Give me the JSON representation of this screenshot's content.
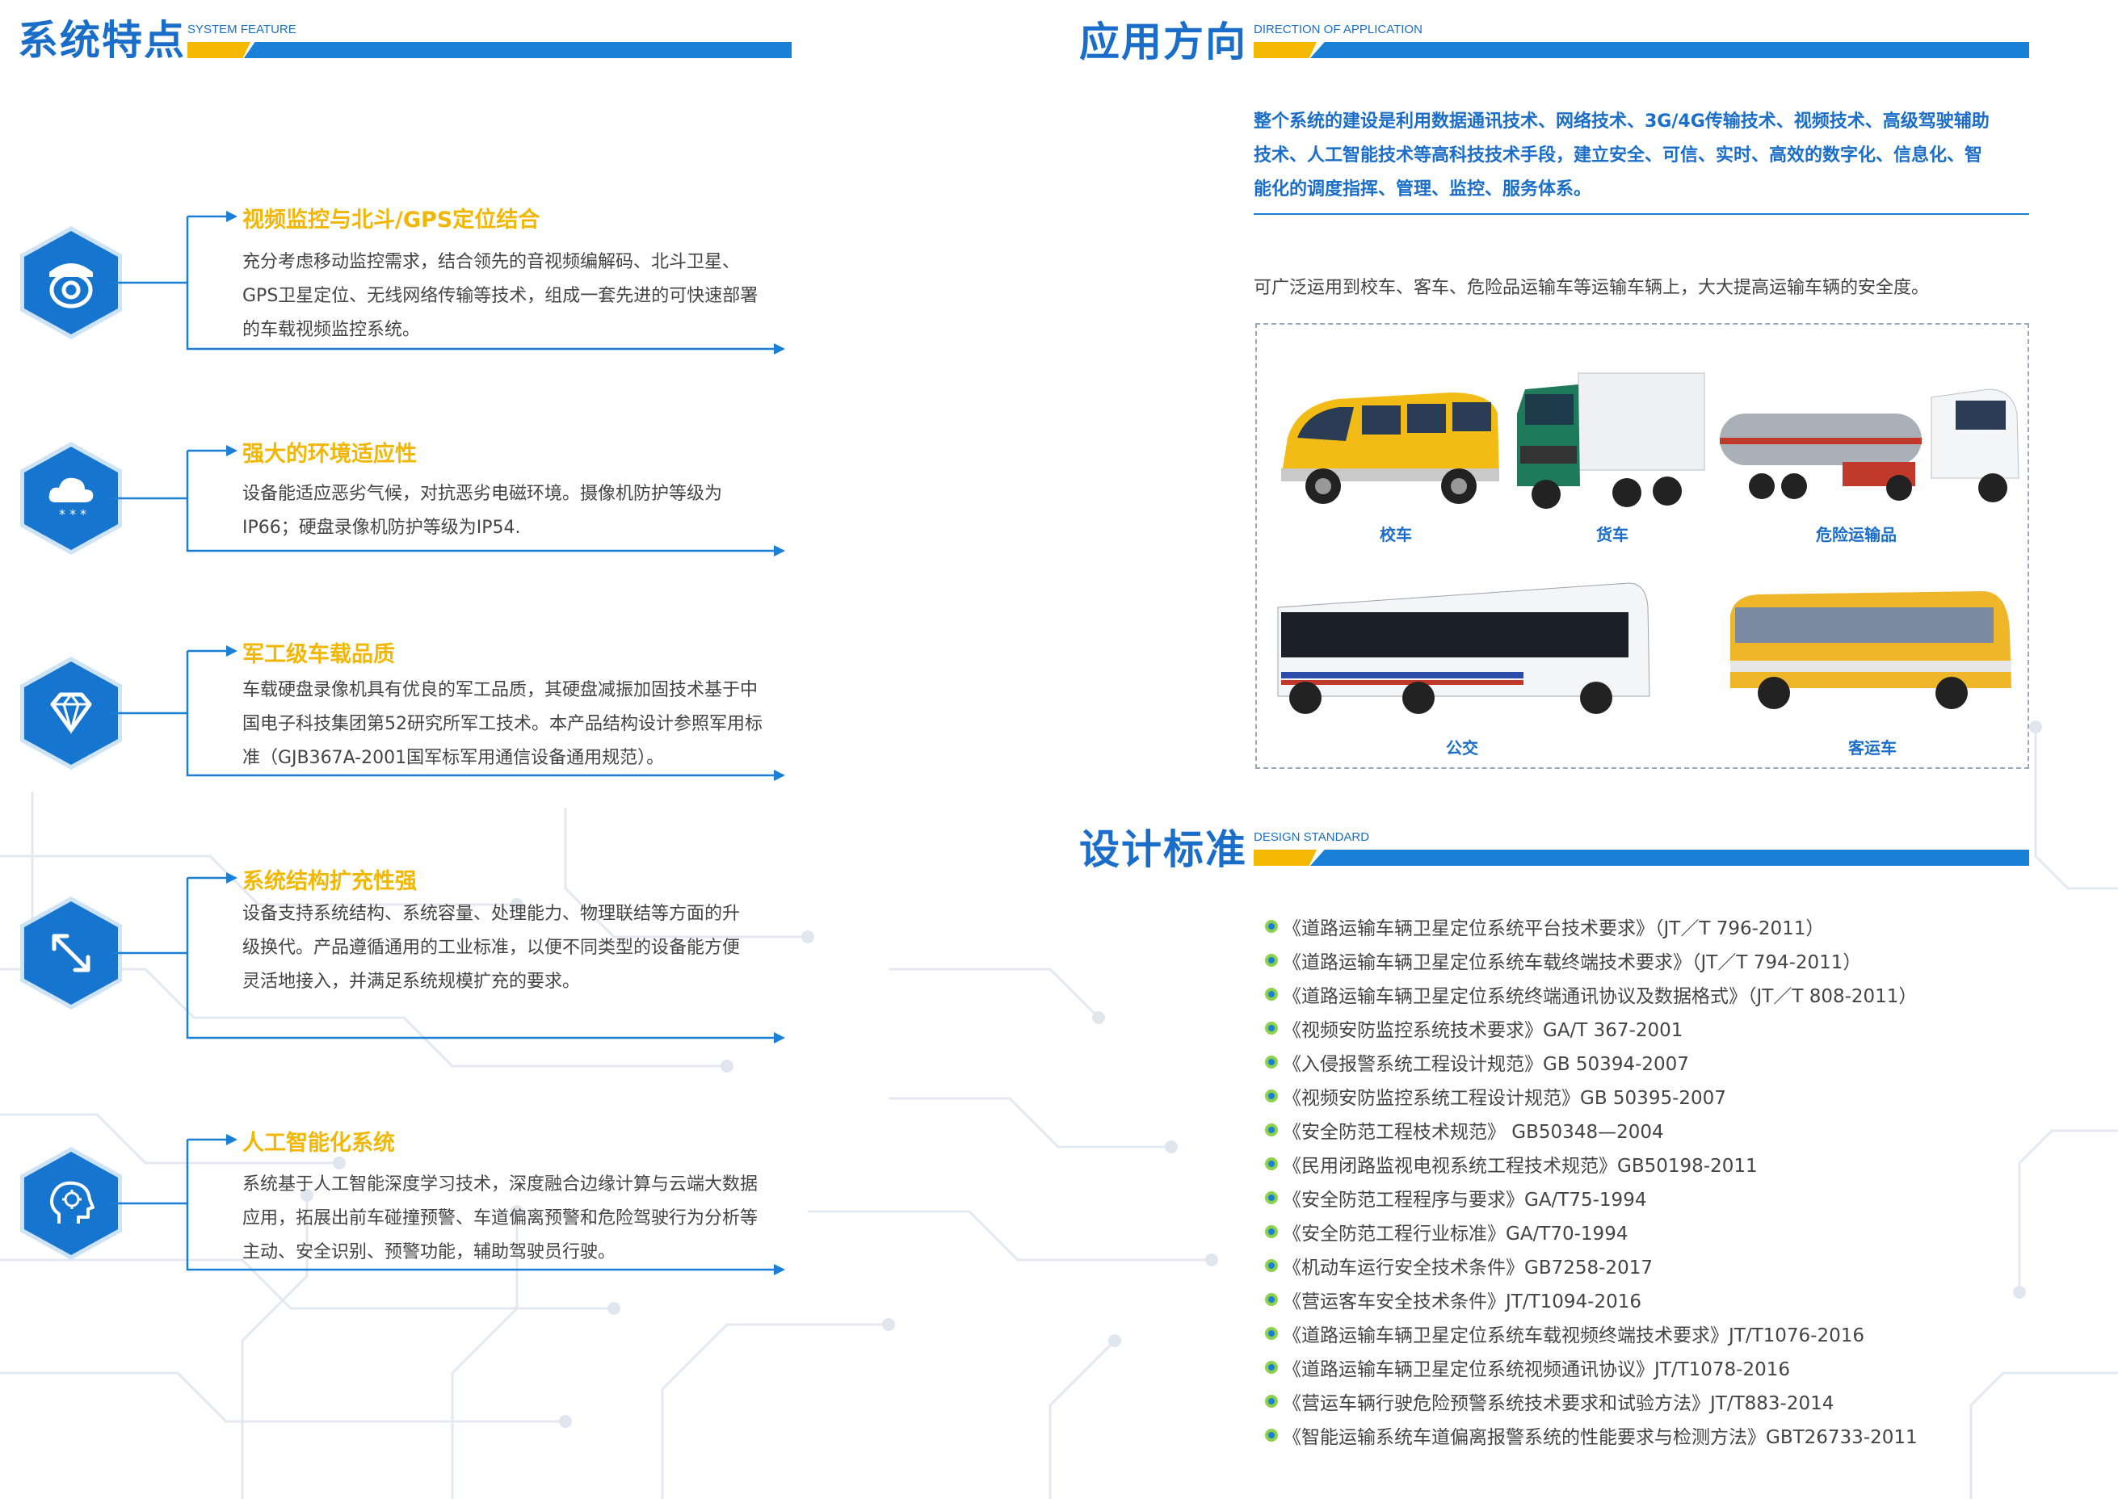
{
  "left": {
    "title": "系统特点",
    "subtitle": "SYSTEM FEATURE",
    "features": [
      {
        "title": "视频监控与北斗/GPS定位结合",
        "lines": [
          "充分考虑移动监控需求，结合领先的音视频编解码、北斗卫星、",
          "GPS卫星定位、无线网络传输等技术，组成一套先进的可快速部署",
          "的车载视频监控系统。"
        ],
        "icon": "camera-icon"
      },
      {
        "title": "强大的环境适应性",
        "lines": [
          "设备能适应恶劣气候，对抗恶劣电磁环境。摄像机防护等级为",
          "IP66；硬盘录像机防护等级为IP54."
        ],
        "icon": "snow-cloud-icon"
      },
      {
        "title": "军工级车载品质",
        "lines": [
          "车载硬盘录像机具有优良的军工品质，其硬盘减振加固技术基于中",
          "国电子科技集团第52研究所军工技术。本产品结构设计参照军用标",
          "准（GJB367A-2001国军标军用通信设备通用规范）。"
        ],
        "icon": "diamond-icon"
      },
      {
        "title": "系统结构扩充性强",
        "lines": [
          "设备支持系统结构、系统容量、处理能力、物理联结等方面的升",
          "级换代。产品遵循通用的工业标准，以便不同类型的设备能方便",
          "灵活地接入，并满足系统规模扩充的要求。"
        ],
        "icon": "expand-arrows-icon"
      },
      {
        "title": "人工智能化系统",
        "lines": [
          "系统基于人工智能深度学习技术，深度融合边缘计算与云端大数据",
          "应用，拓展出前车碰撞预警、车道偏离预警和危险驾驶行为分析等",
          "主动、安全识别、预警功能，辅助驾驶员行驶。"
        ],
        "icon": "ai-head-icon"
      }
    ]
  },
  "application": {
    "title": "应用方向",
    "subtitle": "DIRECTION OF APPLICATION",
    "intro": [
      "整个系统的建设是利用数据通讯技术、网络技术、3G/4G传输技术、视频技术、高级驾驶辅助",
      "技术、人工智能技术等高科技技术手段，建立安全、可信、实时、高效的数字化、信息化、智",
      "能化的调度指挥、管理、监控、服务体系。"
    ],
    "text": "可广泛运用到校车、客车、危险品运输车等运输车辆上，大大提高运输车辆的安全度。",
    "vehicles": [
      "校车",
      "货车",
      "危险运输品",
      "公交",
      "客运车"
    ]
  },
  "standards": {
    "title": "设计标准",
    "subtitle": "DESIGN STANDARD",
    "items": [
      "《道路运输车辆卫星定位系统平台技术要求》（JT／T 796-2011）",
      "《道路运输车辆卫星定位系统车载终端技术要求》（JT／T 794-2011）",
      "《道路运输车辆卫星定位系统终端通讯协议及数据格式》（JT／T 808-2011）",
      "《视频安防监控系统技术要求》GA/T 367-2001",
      "《入侵报警系统工程设计规范》GB 50394-2007",
      "《视频安防监控系统工程设计规范》GB 50395-2007",
      "《安全防范工程枝术规范》 GB50348—2004",
      "《民用闭路监视电视系统工程技术规范》GB50198-2011",
      "《安全防范工程程序与要求》GA/T75-1994",
      "《安全防范工程行业标准》GA/T70-1994",
      "《机动车运行安全技术条件》GB7258-2017",
      "《营运客车安全技术条件》JT/T1094-2016",
      "《道路运输车辆卫星定位系统车载视频终端技术要求》JT/T1076-2016",
      "《道路运输车辆卫星定位系统视频通讯协议》JT/T1078-2016",
      "《营运车辆行驶危险预警系统技术要求和试验方法》JT/T883-2014",
      "《智能运输系统车道偏离报警系统的性能要求与检测方法》GBT26733-2011"
    ]
  },
  "colors": {
    "brand_blue": "#1a6ec9",
    "accent_yellow": "#f2b705",
    "bullet_green": "#8cd14a"
  }
}
